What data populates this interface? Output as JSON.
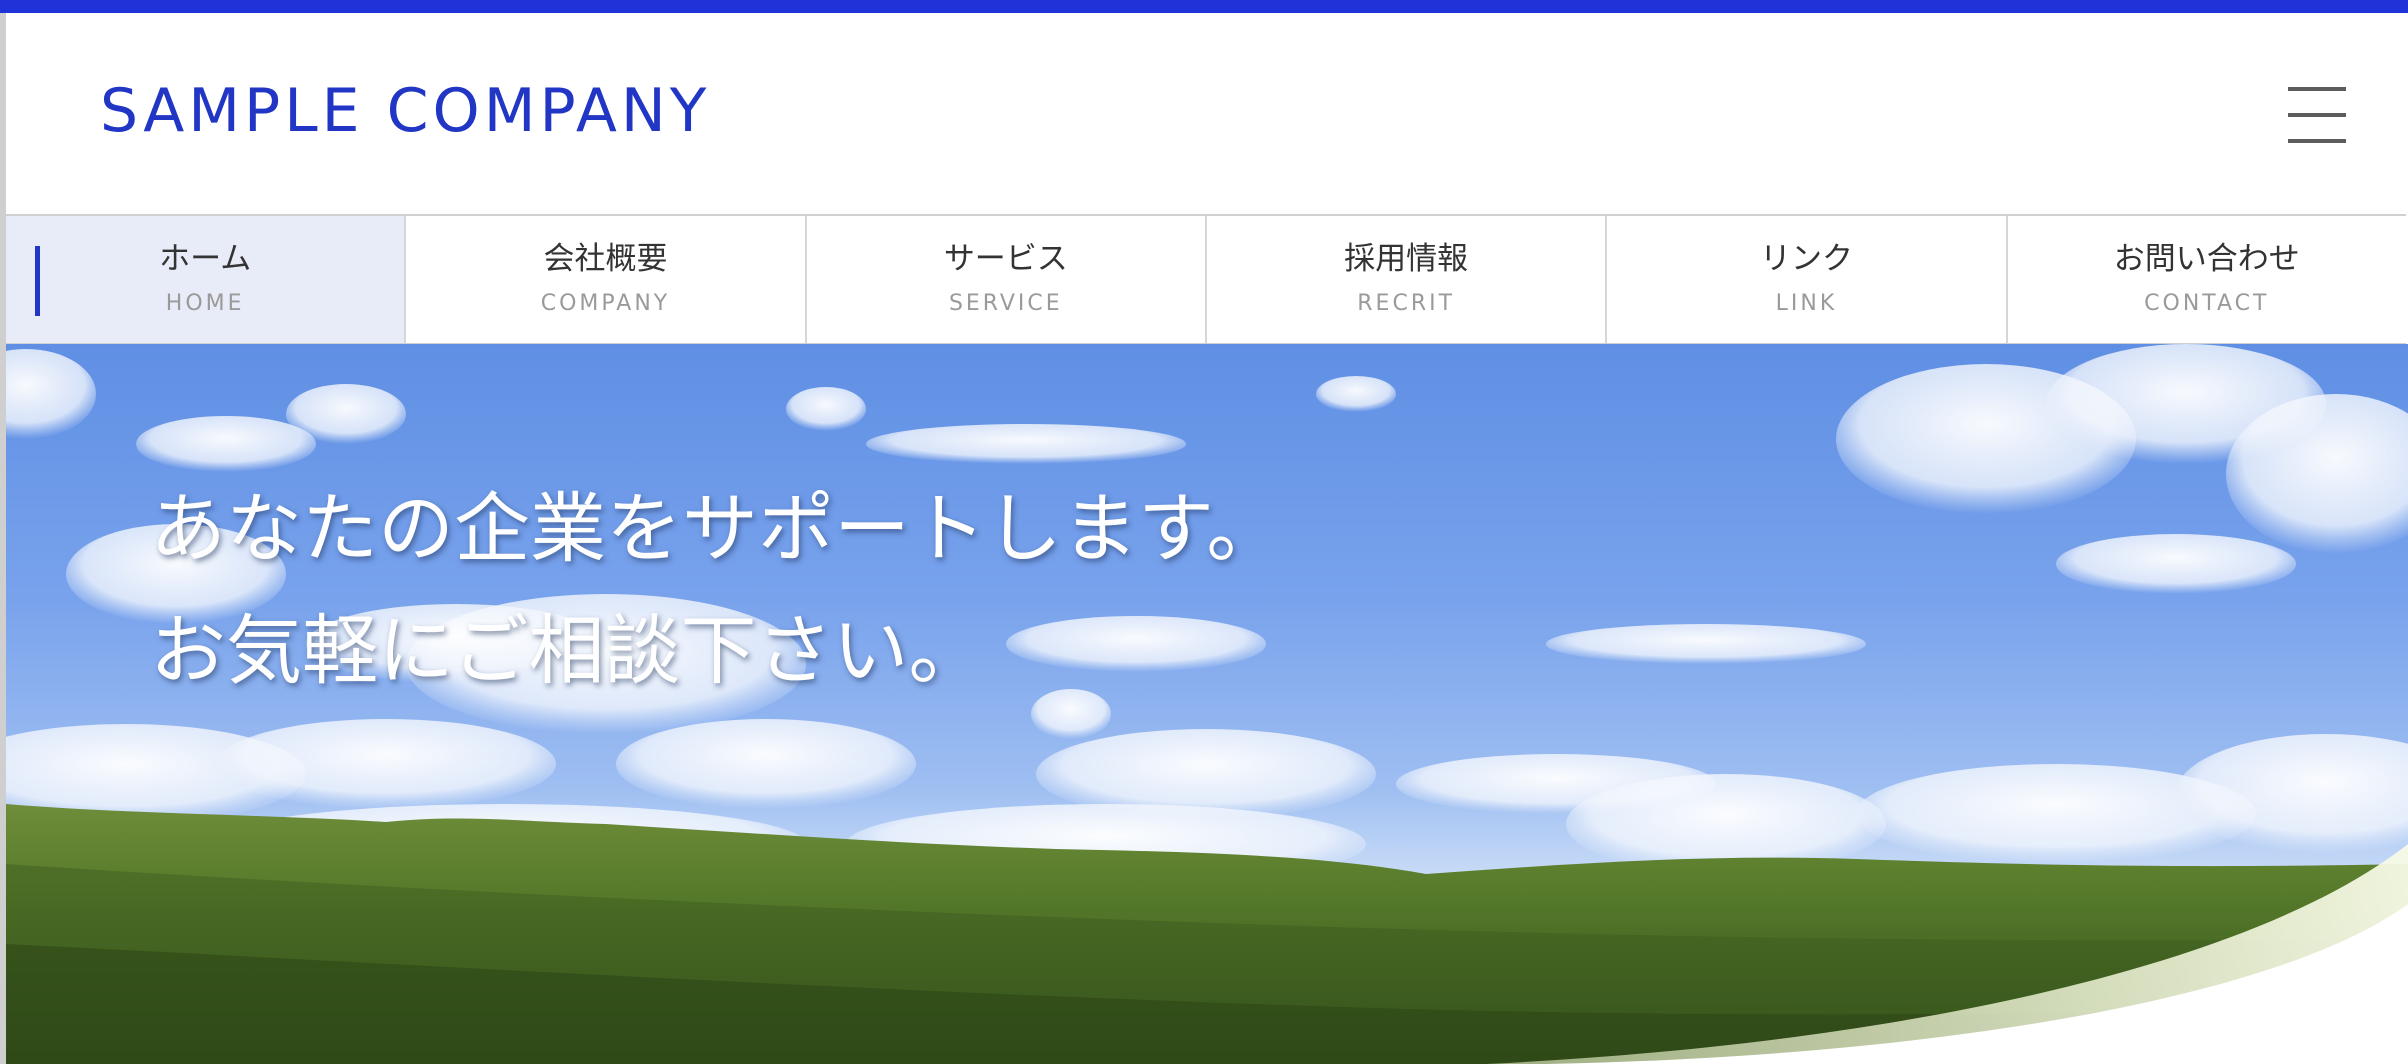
{
  "colors": {
    "accent": "#2136c4",
    "top_bar": "#1f33d8",
    "nav_active_bg": "#e8ebf8",
    "nav_text": "#333333",
    "nav_subtext": "#9a9a9a",
    "hamburger": "#5c5c5c"
  },
  "header": {
    "site_title": "SAMPLE COMPANY",
    "menu_icon": "hamburger-menu-icon"
  },
  "nav": {
    "items": [
      {
        "label": "ホーム",
        "sublabel": "HOME",
        "active": true
      },
      {
        "label": "会社概要",
        "sublabel": "COMPANY",
        "active": false
      },
      {
        "label": "サービス",
        "sublabel": "SERVICE",
        "active": false
      },
      {
        "label": "採用情報",
        "sublabel": "RECRIT",
        "active": false
      },
      {
        "label": "リンク",
        "sublabel": "LINK",
        "active": false
      },
      {
        "label": "お問い合わせ",
        "sublabel": "CONTACT",
        "active": false
      }
    ]
  },
  "hero": {
    "line1": "あなたの企業をサポートします。",
    "line2": "お気軽にご相談下さい。"
  }
}
